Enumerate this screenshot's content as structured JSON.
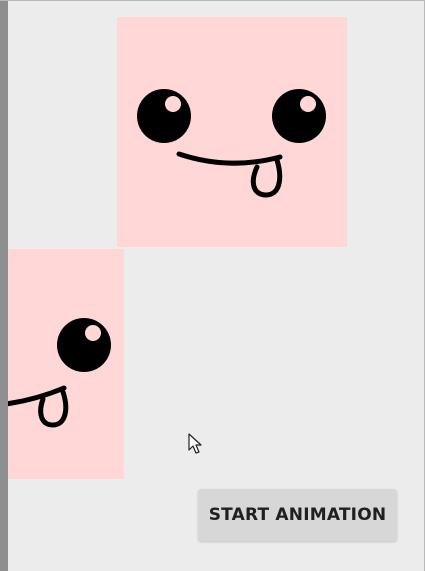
{
  "controls": {
    "start_animation_label": "START ANIMATION"
  },
  "icons": {
    "cursor": "mouse-pointer-icon",
    "face": "smiling-face-icon"
  },
  "colors": {
    "background": "#ececec",
    "face_card": "#ffd7d7",
    "button": "#d7d7d7",
    "button_text": "#202020",
    "eye": "#000000",
    "eye_highlight": "#ffd7d7"
  }
}
